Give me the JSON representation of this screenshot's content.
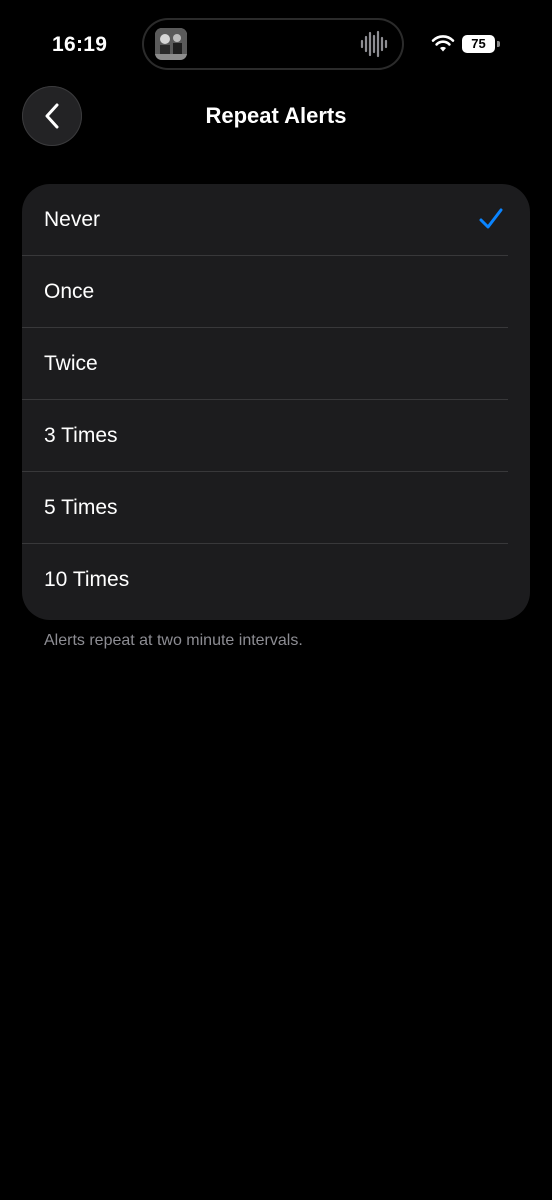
{
  "status_bar": {
    "time": "16:19",
    "battery": "75",
    "icons": [
      "album-art-icon",
      "audio-waveform-icon",
      "wifi-icon",
      "battery-icon"
    ]
  },
  "nav": {
    "back_icon": "chevron-left-icon",
    "title": "Repeat Alerts"
  },
  "options": [
    {
      "label": "Never",
      "selected": true
    },
    {
      "label": "Once",
      "selected": false
    },
    {
      "label": "Twice",
      "selected": false
    },
    {
      "label": "3 Times",
      "selected": false
    },
    {
      "label": "5 Times",
      "selected": false
    },
    {
      "label": "10 Times",
      "selected": false
    }
  ],
  "footer": "Alerts repeat at two minute intervals.",
  "colors": {
    "background": "#000000",
    "card": "#1c1c1e",
    "accent": "#0a84ff",
    "secondary_text": "#8d8d93"
  }
}
